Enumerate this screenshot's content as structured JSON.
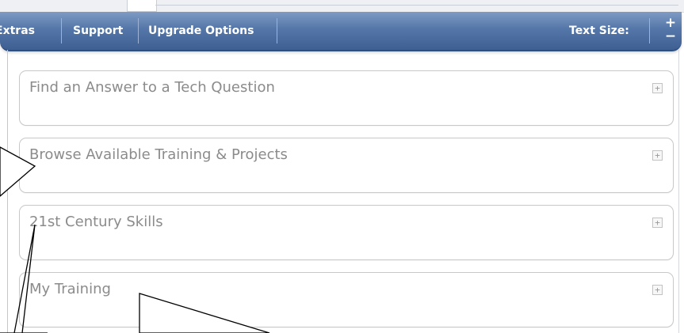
{
  "navbar": {
    "items": [
      {
        "label": "Extras"
      },
      {
        "label": "Support"
      },
      {
        "label": "Upgrade Options"
      }
    ],
    "text_size_label": "Text Size:",
    "increase_symbol": "+",
    "decrease_symbol": "−"
  },
  "panels": [
    {
      "title": "Find an Answer to a Tech Question"
    },
    {
      "title": "Browse Available Training & Projects"
    },
    {
      "title": "21st Century Skills"
    },
    {
      "title": "My Training"
    }
  ],
  "panel_expand_symbol": "+",
  "colors": {
    "navbar": "#4d6fa3",
    "panel_title": "#8b8b8b",
    "panel_border": "#c8c8c8"
  }
}
